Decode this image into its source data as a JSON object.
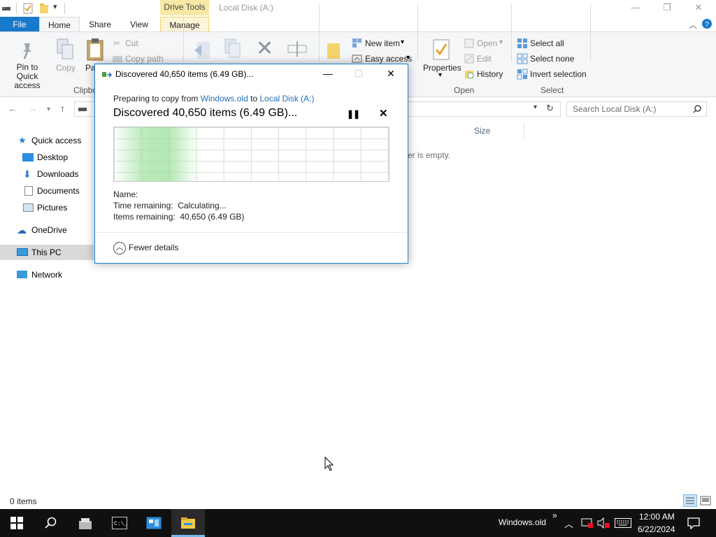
{
  "window": {
    "title": "Local Disk (A:)",
    "context_tab": "Drive Tools",
    "controls": {
      "minimize": "—",
      "restore": "❐",
      "close": "✕"
    }
  },
  "ribbon_tabs": [
    "File",
    "Home",
    "Share",
    "View",
    "Manage"
  ],
  "ribbon": {
    "clipboard": {
      "pin_label": "Pin to Quick access",
      "copy_label": "Copy",
      "paste_label": "Pa",
      "cut_label": "Cut",
      "copy_path_label": "Copy path",
      "group_label": "Clipbo"
    },
    "new": {
      "new_item_label": "New item",
      "easy_access_label": "Easy access"
    },
    "open": {
      "properties_label": "Properties",
      "open_label": "Open",
      "edit_label": "Edit",
      "history_label": "History",
      "group_label": "Open"
    },
    "select": {
      "select_all_label": "Select all",
      "select_none_label": "Select none",
      "invert_label": "Invert selection",
      "group_label": "Select"
    }
  },
  "search": {
    "placeholder": "Search Local Disk (A:)"
  },
  "nav_pane": {
    "quick_access": "Quick access",
    "desktop": "Desktop",
    "downloads": "Downloads",
    "documents": "Documents",
    "pictures": "Pictures",
    "onedrive": "OneDrive",
    "this_pc": "This PC",
    "network": "Network"
  },
  "content": {
    "column_size": "Size",
    "empty_message": "er is empty."
  },
  "status_bar": {
    "items": "0 items"
  },
  "copy_dialog": {
    "title": "Discovered 40,650 items (6.49 GB)...",
    "preparing_prefix": "Preparing to copy from",
    "source": "Windows.old",
    "to_word": "to",
    "destination": "Local Disk (A:)",
    "headline": "Discovered 40,650 items (6.49 GB)...",
    "name_label": "Name:",
    "time_remaining": "Time remaining:  Calculating...",
    "items_remaining": "Items remaining:  40,650 (6.49 GB)",
    "fewer_details": "Fewer details"
  },
  "taskbar": {
    "toolbar_label": "Windows.old",
    "time": "12:00 AM",
    "date": "6/22/2024"
  },
  "colors": {
    "accent": "#1979ca",
    "drive_tools": "#f6e9a6",
    "link": "#1e6fb8",
    "taskbar": "#101010"
  }
}
